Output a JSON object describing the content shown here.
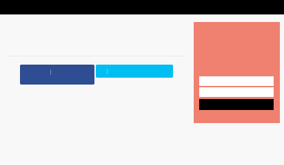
{
  "colors": {
    "status_bar": "#000000",
    "background": "#f8f8f8",
    "divider": "#e6eaf0",
    "facebook_button": "#2e4d93",
    "twitter_button": "#00bdf2",
    "side_panel": "#f08070",
    "input_field": "#ffffff",
    "submit_bar": "#000000"
  },
  "social_buttons": {
    "facebook": {
      "label": "",
      "icon": "facebook-icon"
    },
    "twitter": {
      "label": "",
      "icon": "twitter-icon"
    }
  },
  "side_panel": {
    "field_1": {
      "value": "",
      "placeholder": ""
    },
    "field_2": {
      "value": "",
      "placeholder": ""
    },
    "submit_label": ""
  }
}
